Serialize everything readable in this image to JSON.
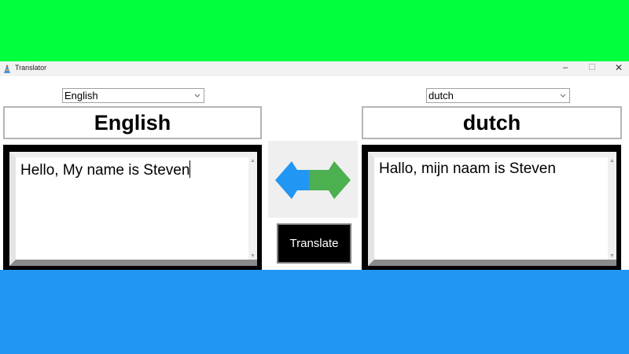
{
  "colors": {
    "top_band": "#00ff3f",
    "bottom_band": "#2196f3",
    "arrow_left": "#2196f3",
    "arrow_right": "#4caf50"
  },
  "window": {
    "title": "Translator",
    "min_label": "–",
    "max_label": "☐",
    "close_label": "✕"
  },
  "source": {
    "language_selected": "English",
    "header": "English",
    "text": "Hello, My name is Steven"
  },
  "target": {
    "language_selected": "dutch",
    "header": "dutch",
    "text": "Hallo, mijn naam is Steven"
  },
  "icons": {
    "dropdown": "chevron-down-icon",
    "swap": "swap-arrows-icon",
    "scroll_up": "▲",
    "scroll_down": "▼"
  },
  "translate_button": {
    "label": "Translate"
  }
}
